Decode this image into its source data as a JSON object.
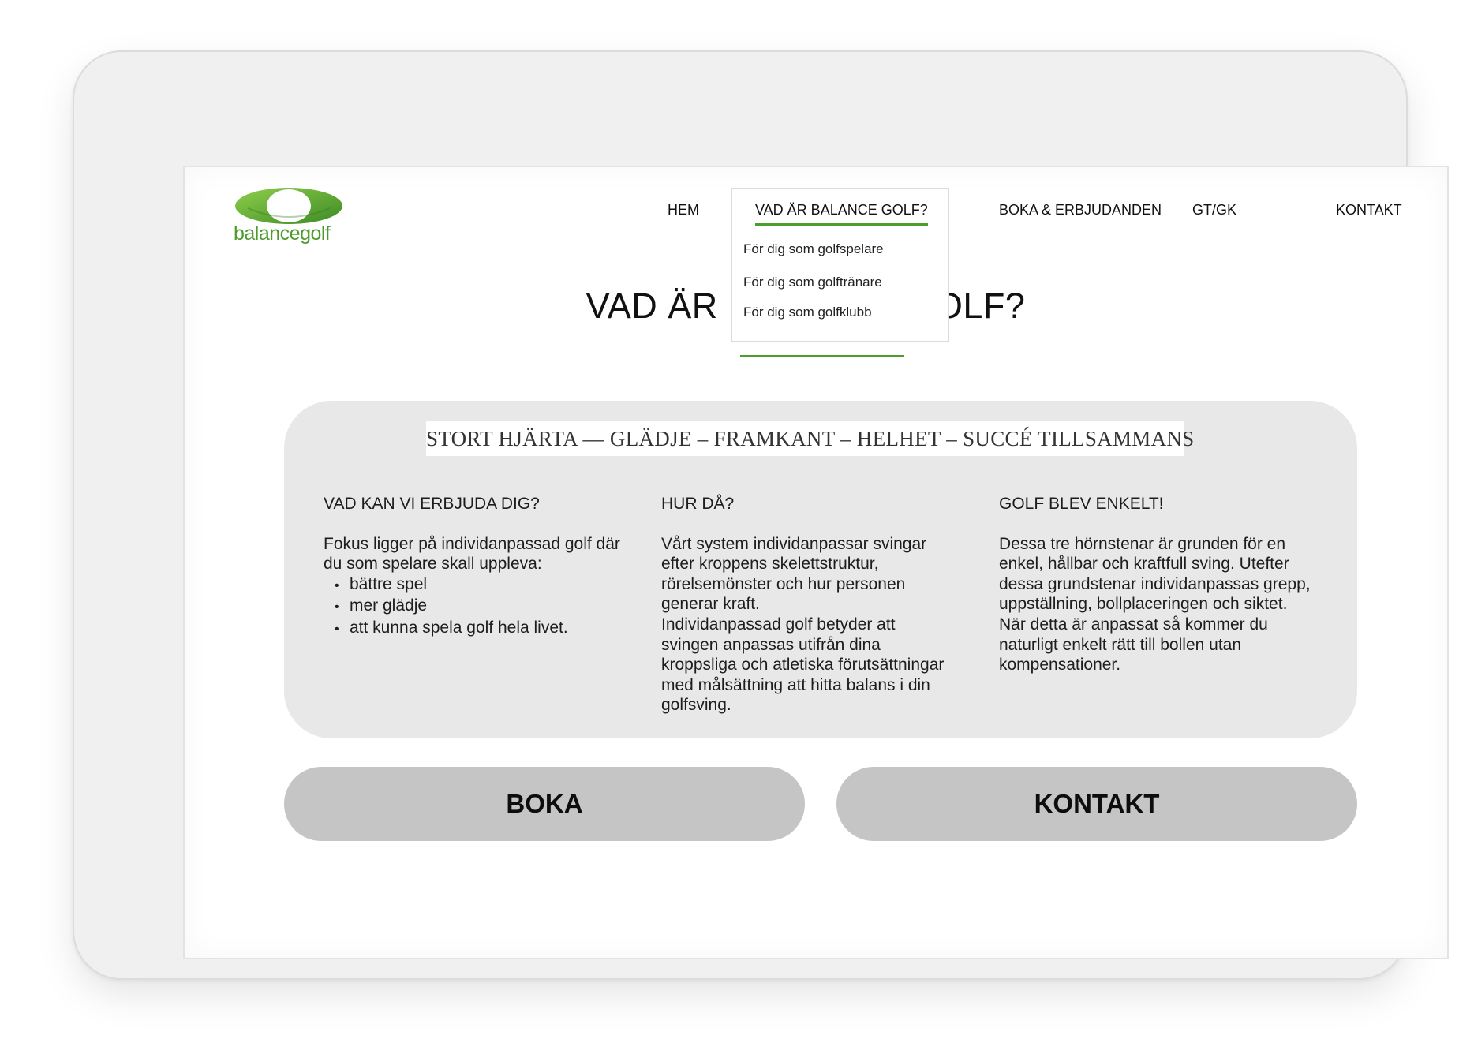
{
  "header": {
    "logo_text": "balancegolf",
    "nav": [
      {
        "label": "HEM"
      },
      {
        "label": "VAD ÄR BALANCE GOLF?"
      },
      {
        "label": "BOKA & ERBJUDANDEN"
      },
      {
        "label": "GT/GK"
      },
      {
        "label": "KONTAKT"
      }
    ],
    "active_nav": "VAD ÄR BALANCE GOLF?",
    "dropdown": [
      "För dig som golfspelare",
      "För dig som golftränare",
      "För dig som golfklubb"
    ]
  },
  "page": {
    "title": "VAD ÄR BALANCE GOLF?",
    "motto": "STORT HJÄRTA — GLÄDJE – FRAMKANT – HELHET – SUCCÉ TILLSAMMANS"
  },
  "columns": [
    {
      "heading": "VAD KAN VI ERBJUDA DIG?",
      "text": "Fokus ligger på individanpassad golf där du som spelare skall uppleva:",
      "bullets": [
        "bättre spel",
        "mer glädje",
        "att kunna spela golf hela livet."
      ]
    },
    {
      "heading": "HUR DÅ?",
      "text": "Vårt system individanpassar svingar efter kroppens skelettstruktur, rörelsemönster och hur personen generar kraft.",
      "text2": "Individanpassad golf betyder att svingen anpassas utifrån dina kroppsliga och atletiska förutsättningar med målsättning att hitta balans i din golfsving."
    },
    {
      "heading": "GOLF BLEV ENKELT!",
      "text": "Dessa tre hörnstenar är grunden för en enkel, hållbar och kraftfull sving. Utefter dessa grundstenar individanpassas grepp, uppställning, bollplaceringen och siktet. När detta är anpassat så kommer du naturligt enkelt rätt till bollen utan kompensationer."
    }
  ],
  "buttons": {
    "book": "BOKA",
    "contact": "KONTAKT"
  },
  "colors": {
    "accent_green": "#4a9e2b",
    "logo_green_light": "#7cc242",
    "logo_green_dark": "#3c8a26",
    "card_bg": "#e8e8e8",
    "button_bg": "#c5c5c5"
  }
}
